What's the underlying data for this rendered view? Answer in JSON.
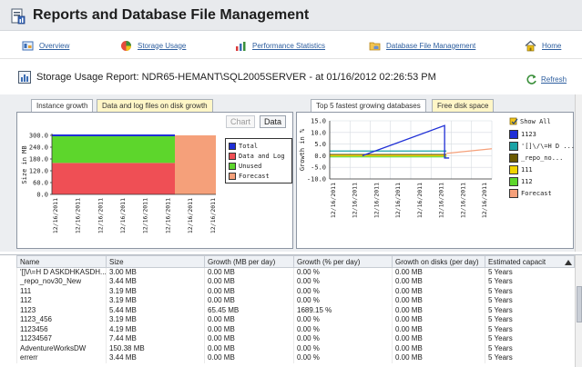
{
  "app": {
    "title": "Reports and Database File Management"
  },
  "nav": [
    {
      "label": "Overview",
      "icon": "overview-icon"
    },
    {
      "label": "Storage Usage",
      "icon": "storage-icon"
    },
    {
      "label": "Performance Statistics",
      "icon": "performance-chart-icon"
    },
    {
      "label": "Database File Management",
      "icon": "database-file-icon"
    },
    {
      "label": "Home",
      "icon": "home-icon"
    }
  ],
  "report": {
    "title": "Storage Usage Report: NDR65-HEMANT\\SQL2005SERVER - at 01/16/2012 02:26:53 PM",
    "refresh_label": "Refresh"
  },
  "left_panel": {
    "tabs": [
      "Instance growth",
      "Data and log files on disk growth"
    ],
    "buttons": {
      "chart": "Chart",
      "data": "Data"
    }
  },
  "right_panel": {
    "tabs": [
      "Top 5 fastest growing databases",
      "Free disk space"
    ],
    "show_all": "Show All"
  },
  "chart_data": [
    {
      "type": "area",
      "title": "",
      "xlabel": "",
      "ylabel": "Size in MB",
      "ylim": [
        0,
        300
      ],
      "yticks": [
        "0.0",
        "60.0",
        "120.0",
        "180.0",
        "240.0",
        "300.0"
      ],
      "x": [
        "12/16/2011",
        "12/16/2011",
        "12/16/2011",
        "12/16/2011",
        "12/16/2011",
        "12/16/2011",
        "12/16/2011",
        "12/16/2011"
      ],
      "series": [
        {
          "name": "Total",
          "color": "#1f2fd6",
          "values": [
            300,
            300,
            300,
            300,
            300,
            300
          ]
        },
        {
          "name": "Data and Log",
          "color": "#ef4f55",
          "values": [
            160,
            160,
            160,
            160,
            160,
            160
          ]
        },
        {
          "name": "Unused",
          "color": "#5dd62c",
          "values": [
            140,
            140,
            140,
            140,
            140,
            140
          ]
        },
        {
          "name": "Forecast",
          "color": "#f5a07a",
          "values": [
            300,
            300
          ]
        }
      ],
      "grid": false,
      "legend": "right"
    },
    {
      "type": "line",
      "title": "",
      "xlabel": "",
      "ylabel": "Growth in %",
      "ylim": [
        -10,
        15
      ],
      "yticks": [
        "-10.0",
        "-5.0",
        "0.0",
        "5.0",
        "10.0",
        "15.0"
      ],
      "x": [
        "12/16/2011",
        "12/16/2011",
        "12/16/2011",
        "12/16/2011",
        "12/16/2011",
        "12/16/2011",
        "12/16/2011",
        "12/16/2011"
      ],
      "series": [
        {
          "name": "1123",
          "color": "#1f2fd6",
          "values": [
            0,
            2,
            4,
            6,
            8,
            11,
            13,
            -1,
            -1
          ]
        },
        {
          "name": "'[]\\/\\=H D ...",
          "color": "#1aa3a6",
          "values": [
            2,
            2,
            2,
            2,
            2,
            2,
            2,
            2,
            2
          ]
        },
        {
          "name": "_repo_no...",
          "color": "#6b5a00",
          "values": [
            0.5,
            0.5,
            0.5,
            0.5,
            0.5,
            0.5,
            0.5,
            0.5,
            0.5
          ]
        },
        {
          "name": "111",
          "color": "#f0d400",
          "values": [
            0,
            0,
            0,
            0,
            0,
            0,
            0,
            0,
            0
          ]
        },
        {
          "name": "112",
          "color": "#5dd62c",
          "values": [
            -0.5,
            -0.5,
            -0.5,
            -0.5,
            -0.5,
            -0.5,
            -0.5,
            -0.5,
            -0.5
          ]
        },
        {
          "name": "Forecast",
          "color": "#f5a07a",
          "values": [
            1,
            3
          ]
        }
      ],
      "grid": true,
      "legend": "right"
    }
  ],
  "table": {
    "columns": [
      "Name",
      "Size",
      "Growth (MB per day)",
      "Growth (% per day)",
      "Growth on disks (per day)",
      "Estimated capacit"
    ],
    "rows": [
      [
        "'[]\\/\\=H D ASKDHKASDH...",
        "3.00 MB",
        "0.00 MB",
        "0.00 %",
        "0.00 MB",
        "5 Years"
      ],
      [
        "_repo_nov30_New",
        "3.44 MB",
        "0.00 MB",
        "0.00 %",
        "0.00 MB",
        "5 Years"
      ],
      [
        "111",
        "3.19 MB",
        "0.00 MB",
        "0.00 %",
        "0.00 MB",
        "5 Years"
      ],
      [
        "112",
        "3.19 MB",
        "0.00 MB",
        "0.00 %",
        "0.00 MB",
        "5 Years"
      ],
      [
        "1123",
        "5.44 MB",
        "65.45 MB",
        "1689.15 %",
        "0.00 MB",
        "5 Years"
      ],
      [
        "1123_456",
        "3.19 MB",
        "0.00 MB",
        "0.00 %",
        "0.00 MB",
        "5 Years"
      ],
      [
        "1123456",
        "4.19 MB",
        "0.00 MB",
        "0.00 %",
        "0.00 MB",
        "5 Years"
      ],
      [
        "11234567",
        "7.44 MB",
        "0.00 MB",
        "0.00 %",
        "0.00 MB",
        "5 Years"
      ],
      [
        "AdventureWorksDW",
        "150.38 MB",
        "0.00 MB",
        "0.00 %",
        "0.00 MB",
        "5 Years"
      ],
      [
        "errerr",
        "3.44 MB",
        "0.00 MB",
        "0.00 %",
        "0.00 MB",
        "5 Years"
      ]
    ]
  }
}
